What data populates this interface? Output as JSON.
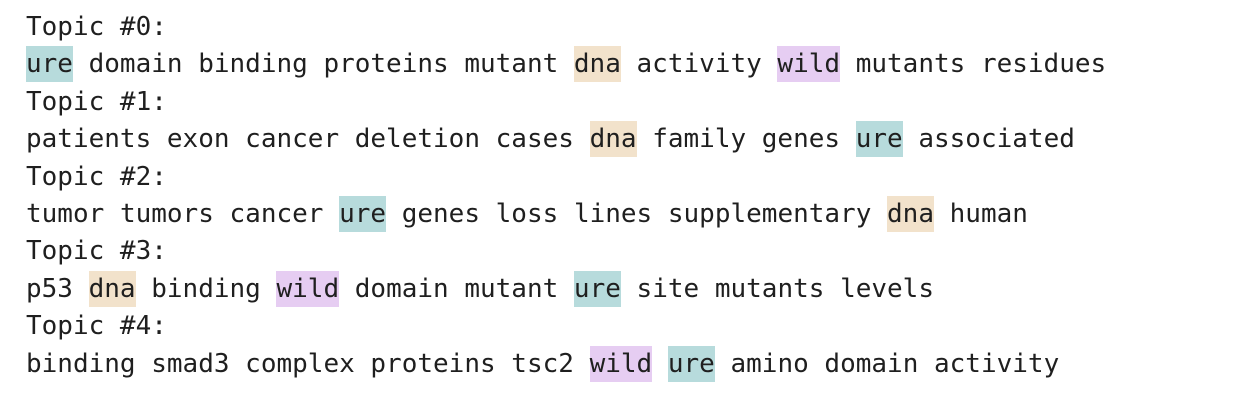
{
  "topics": [
    {
      "heading": "Topic #0:",
      "words": [
        "ure",
        "domain",
        "binding",
        "proteins",
        "mutant",
        "dna",
        "activity",
        "wild",
        "mutants",
        "residues"
      ]
    },
    {
      "heading": "Topic #1:",
      "words": [
        "patients",
        "exon",
        "cancer",
        "deletion",
        "cases",
        "dna",
        "family",
        "genes",
        "ure",
        "associated"
      ]
    },
    {
      "heading": "Topic #2:",
      "words": [
        "tumor",
        "tumors",
        "cancer",
        "ure",
        "genes",
        "loss",
        "lines",
        "supplementary",
        "dna",
        "human"
      ]
    },
    {
      "heading": "Topic #3:",
      "words": [
        "p53",
        "dna",
        "binding",
        "wild",
        "domain",
        "mutant",
        "ure",
        "site",
        "mutants",
        "levels"
      ]
    },
    {
      "heading": "Topic #4:",
      "words": [
        "binding",
        "smad3",
        "complex",
        "proteins",
        "tsc2",
        "wild",
        "ure",
        "amino",
        "domain",
        "activity"
      ]
    }
  ],
  "highlight_colors": {
    "ure": "#b7dbdc",
    "dna": "#f2e2cb",
    "wild": "#e6cdf2"
  }
}
